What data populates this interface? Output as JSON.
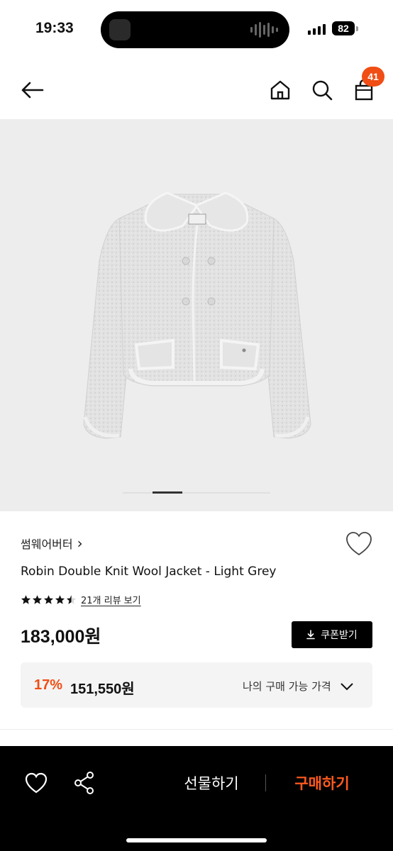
{
  "status_bar": {
    "time": "19:33",
    "battery": "82"
  },
  "header": {
    "back_icon": "arrow-left-icon",
    "home_icon": "home-icon",
    "search_icon": "search-icon",
    "cart_icon": "shopping-bag-icon",
    "cart_count": "41"
  },
  "gallery": {
    "image": "grey double-breasted knit jacket",
    "active_slide_fraction": 0.2
  },
  "product": {
    "brand": "썸웨어버터",
    "brand_chevron": "›",
    "name": "Robin Double Knit Wool Jacket - Light Grey",
    "rating": 4.5,
    "review_link": "21개 리뷰 보기",
    "price": "183,000원",
    "coupon_label": "쿠폰받기",
    "discount_percent": "17%",
    "discount_price": "151,550원",
    "my_price_label": "나의 구매 가능 가격"
  },
  "bottom_bar": {
    "gift_label": "선물하기",
    "buy_label": "구매하기"
  },
  "colors": {
    "accent": "#f04e14",
    "buy_text": "#ff5a1f",
    "bottom_bar_bg": "#000000",
    "hero_bg": "#ededed"
  }
}
